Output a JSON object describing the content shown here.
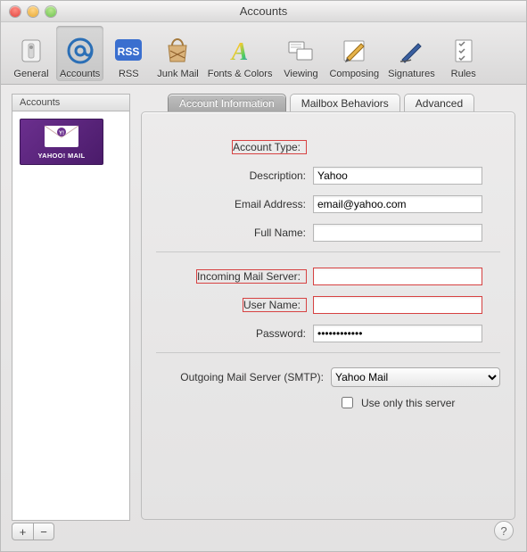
{
  "window_title": "Accounts",
  "toolbar": [
    {
      "id": "general",
      "label": "General"
    },
    {
      "id": "accounts",
      "label": "Accounts"
    },
    {
      "id": "rss",
      "label": "RSS"
    },
    {
      "id": "junk",
      "label": "Junk Mail"
    },
    {
      "id": "fonts",
      "label": "Fonts & Colors"
    },
    {
      "id": "viewing",
      "label": "Viewing"
    },
    {
      "id": "composing",
      "label": "Composing"
    },
    {
      "id": "signatures",
      "label": "Signatures"
    },
    {
      "id": "rules",
      "label": "Rules"
    }
  ],
  "sidebar": {
    "header": "Accounts",
    "items": [
      {
        "brand": "YAHOO! MAIL"
      }
    ],
    "add_label": "+",
    "remove_label": "−"
  },
  "tabs": {
    "info": "Account Information",
    "mailbox": "Mailbox Behaviors",
    "advanced": "Advanced",
    "selected": "info"
  },
  "form": {
    "account_type_label": "Account Type:",
    "account_type_value": "",
    "description_label": "Description:",
    "description_value": "Yahoo",
    "email_label": "Email Address:",
    "email_value": "email@yahoo.com",
    "fullname_label": "Full Name:",
    "fullname_value": "",
    "incoming_label": "Incoming Mail Server:",
    "incoming_value": "",
    "username_label": "User Name:",
    "username_value": "",
    "password_label": "Password:",
    "password_value": "••••••••••••",
    "smtp_label": "Outgoing Mail Server (SMTP):",
    "smtp_value": "Yahoo Mail",
    "use_only_label": "Use only this server",
    "use_only_checked": false
  },
  "help_tooltip": "?"
}
